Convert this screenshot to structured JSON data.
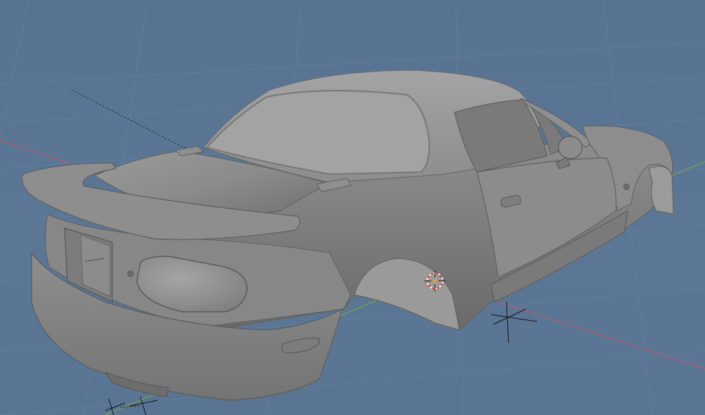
{
  "viewport": {
    "label": "3D Viewport",
    "shading": "solid",
    "background_color": "#5a7594",
    "grid_color": "#6a84a0",
    "x_axis_color": "#c9556a",
    "y_axis_color": "#7fae3e",
    "model_color": "#8a8a8a"
  },
  "scene": {
    "object": "car-body",
    "origin_marker": "3d-cursor",
    "empties": [
      "empty-axes-wheel",
      "empty-axes-front",
      "empty-axes-rear"
    ]
  }
}
